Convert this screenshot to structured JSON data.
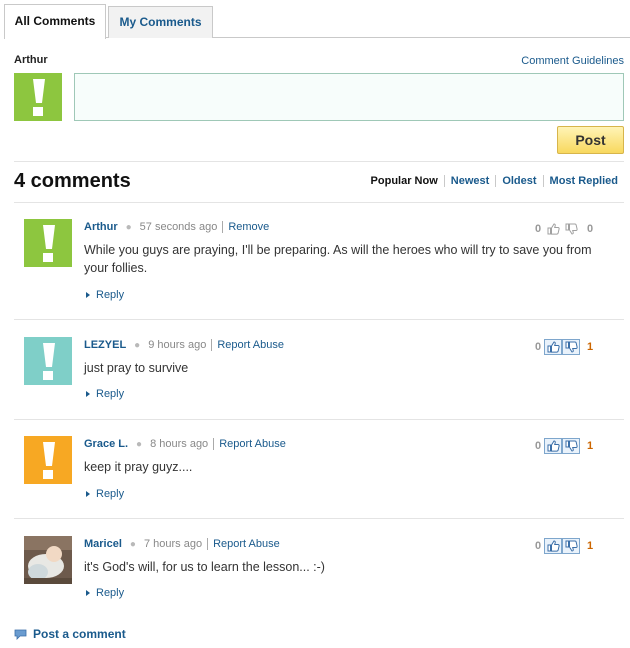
{
  "tabs": [
    {
      "label": "All Comments"
    },
    {
      "label": "My Comments"
    }
  ],
  "compose": {
    "username": "Arthur",
    "guidelines_label": "Comment Guidelines",
    "input_value": "",
    "avatar_color": "#8dc63f",
    "post_label": "Post"
  },
  "summary": {
    "count_label": "4 comments"
  },
  "sort": {
    "options": [
      "Popular Now",
      "Newest",
      "Oldest",
      "Most Replied"
    ],
    "active": "Popular Now"
  },
  "comments": [
    {
      "author": "Arthur",
      "time": "57 seconds ago",
      "action": "Remove",
      "text": "While you guys are praying, I'll be preparing. As will the heroes who will try to save you from your follies.",
      "reply_label": "Reply",
      "up_votes": "0",
      "down_votes": "0",
      "avatar": "exclamation-green",
      "avatar_color": "#8dc63f"
    },
    {
      "author": "LEZYEL",
      "time": "9 hours ago",
      "action": "Report Abuse",
      "text": "just pray to survive",
      "reply_label": "Reply",
      "up_votes": "0",
      "down_votes": "1",
      "avatar": "exclamation-teal",
      "avatar_color": "#7fcfc8"
    },
    {
      "author": "Grace L.",
      "time": "8 hours ago",
      "action": "Report Abuse",
      "text": "keep it pray guyz....",
      "reply_label": "Reply",
      "up_votes": "0",
      "down_votes": "1",
      "avatar": "exclamation-orange",
      "avatar_color": "#f7a823"
    },
    {
      "author": "Maricel",
      "time": "7 hours ago",
      "action": "Report Abuse",
      "text": "it's God's will, for us to learn the lesson... :-)",
      "reply_label": "Reply",
      "up_votes": "0",
      "down_votes": "1",
      "avatar": "photo-baby"
    }
  ],
  "footer": {
    "post_comment_label": "Post a comment"
  }
}
